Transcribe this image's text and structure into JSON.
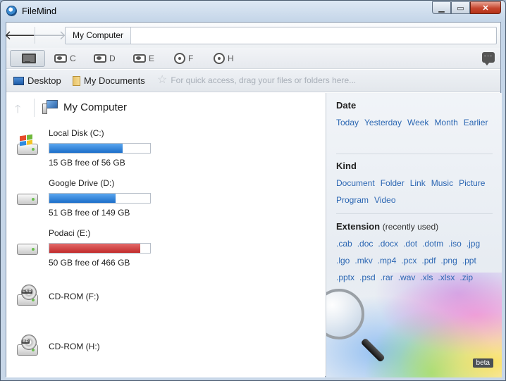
{
  "window": {
    "title": "FileMind"
  },
  "nav": {
    "address": "My Computer"
  },
  "drive_tabs": [
    {
      "letter": "C",
      "icon": "hdd-icon"
    },
    {
      "letter": "D",
      "icon": "hdd-icon"
    },
    {
      "letter": "E",
      "icon": "hdd-icon"
    },
    {
      "letter": "F",
      "icon": "cd-icon"
    },
    {
      "letter": "H",
      "icon": "cd-icon"
    }
  ],
  "quick_access": {
    "desktop": "Desktop",
    "documents": "My Documents",
    "hint": "For quick access, drag your files or folders here..."
  },
  "left": {
    "title": "My Computer",
    "drives": [
      {
        "name": "Local Disk (C:)",
        "free": "15 GB free of 56 GB",
        "used_fraction": 0.73,
        "color": "#1c6ec9"
      },
      {
        "name": "Google Drive (D:)",
        "free": "51 GB free of 149 GB",
        "used_fraction": 0.66,
        "color": "#1c6ec9"
      },
      {
        "name": "Podaci (E:)",
        "free": "50 GB free of 466 GB",
        "used_fraction": 0.9,
        "color": "#c12b2b"
      },
      {
        "name": "CD-ROM (F:)",
        "disc": "DVD"
      },
      {
        "name": "CD-ROM (H:)",
        "disc": "BD"
      }
    ]
  },
  "filters": {
    "date": {
      "title": "Date",
      "items": [
        "Today",
        "Yesterday",
        "Week",
        "Month",
        "Earlier"
      ]
    },
    "kind": {
      "title": "Kind",
      "items": [
        "Document",
        "Folder",
        "Link",
        "Music",
        "Picture",
        "Program",
        "Video"
      ]
    },
    "extension": {
      "title": "Extension",
      "subtitle": "(recently used)",
      "items": [
        ".cab",
        ".doc",
        ".docx",
        ".dot",
        ".dotm",
        ".iso",
        ".jpg",
        ".lgo",
        ".mkv",
        ".mp4",
        ".pcx",
        ".pdf",
        ".png",
        ".ppt",
        ".pptx",
        ".psd",
        ".rar",
        ".wav",
        ".xls",
        ".xlsx",
        ".zip"
      ]
    }
  },
  "badge": "beta"
}
